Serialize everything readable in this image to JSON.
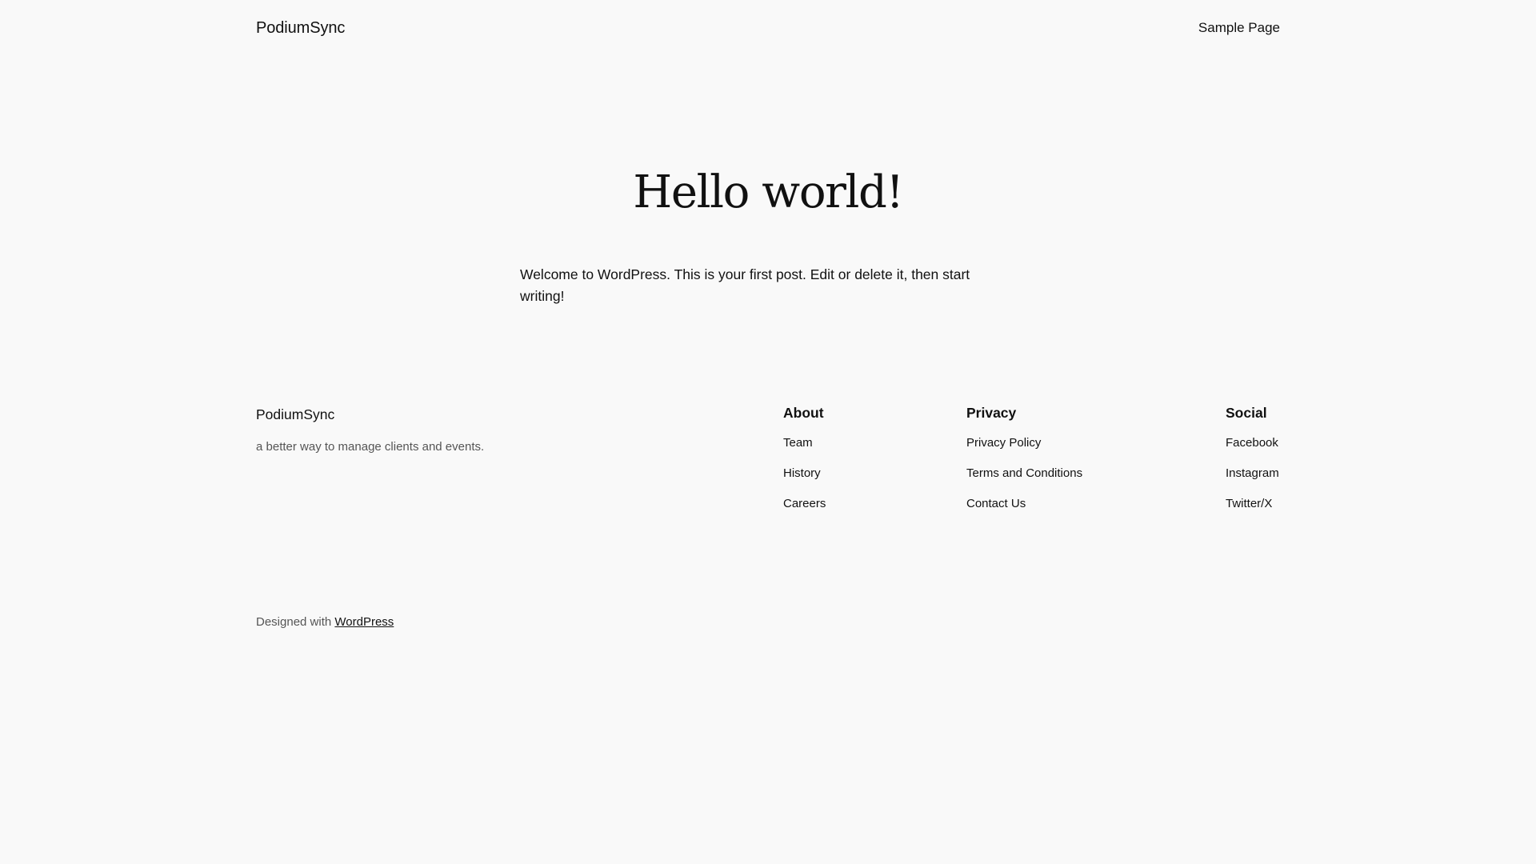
{
  "header": {
    "site_title": "PodiumSync",
    "nav": [
      {
        "label": "Sample Page"
      }
    ]
  },
  "post": {
    "title": "Hello world!",
    "content": "Welcome to WordPress. This is your first post. Edit or delete it, then start writing!"
  },
  "footer": {
    "site_title": "PodiumSync",
    "tagline": "a better way to manage clients and events.",
    "columns": [
      {
        "heading": "About",
        "links": [
          "Team",
          "History",
          "Careers"
        ]
      },
      {
        "heading": "Privacy",
        "links": [
          "Privacy Policy",
          "Terms and Conditions",
          "Contact Us"
        ]
      },
      {
        "heading": "Social",
        "links": [
          "Facebook",
          "Instagram",
          "Twitter/X"
        ]
      }
    ],
    "credits_prefix": "Designed with ",
    "credits_link": "WordPress"
  },
  "colors": {
    "background": "#f9f9f9",
    "text": "#111111",
    "muted": "#555555"
  }
}
